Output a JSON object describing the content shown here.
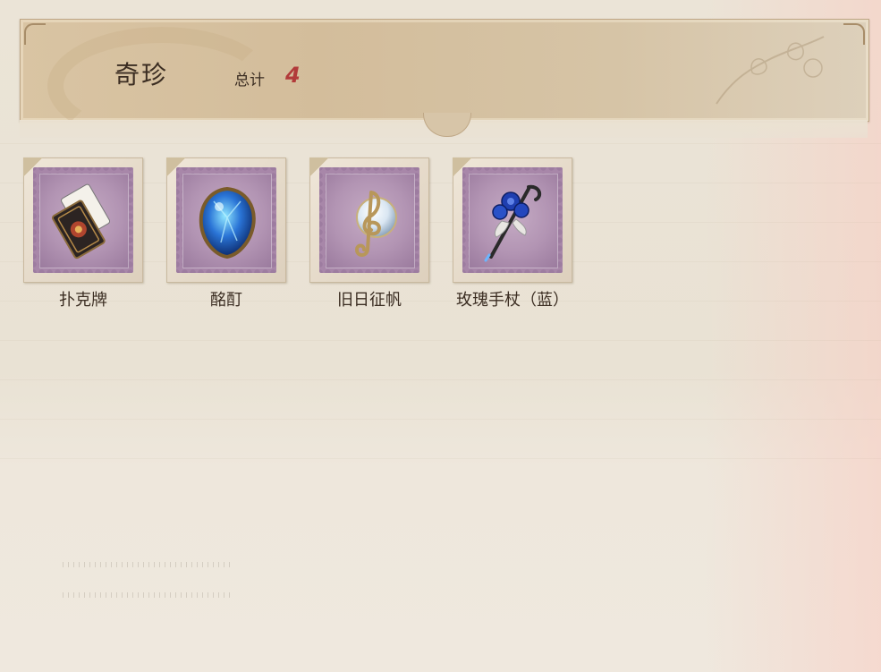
{
  "header": {
    "title": "奇珍",
    "total_label": "总计",
    "total_count": "4"
  },
  "items": [
    {
      "name": "扑克牌",
      "icon": "card-deck-icon"
    },
    {
      "name": "酩酊",
      "icon": "blue-crystal-heart-icon"
    },
    {
      "name": "旧日征帆",
      "icon": "treble-clef-orb-icon"
    },
    {
      "name": "玫瑰手杖（蓝）",
      "icon": "blue-rose-cane-icon"
    }
  ],
  "colors": {
    "accent_count": "#b23a3a",
    "stamp_purple": "#9d7ca0",
    "text": "#3b2d22"
  }
}
